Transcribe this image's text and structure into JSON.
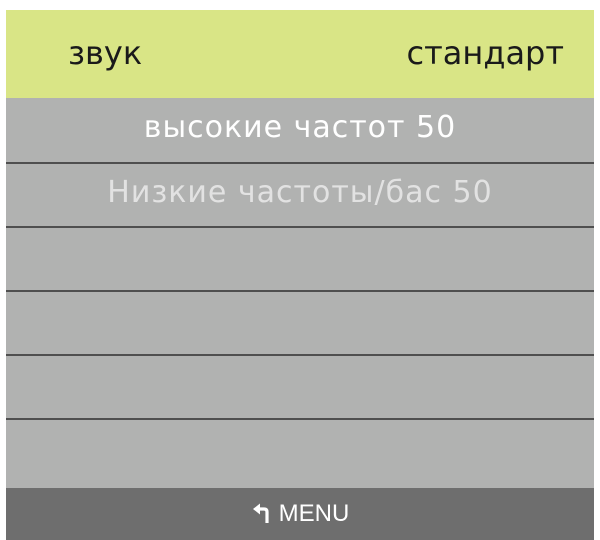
{
  "header": {
    "title": "звук",
    "value": "стандарт"
  },
  "menu": {
    "items": [
      {
        "label": "высокие частот  50"
      },
      {
        "label": "Низкие частоты/бас 50"
      },
      {
        "label": ""
      },
      {
        "label": ""
      },
      {
        "label": ""
      },
      {
        "label": ""
      }
    ]
  },
  "footer": {
    "icon": "back-arrow-icon",
    "label": "MENU"
  },
  "colors": {
    "header_bg": "#d9e586",
    "list_bg": "#b1b2b1",
    "footer_bg": "#6e6e6e",
    "divider": "#4f4f4f"
  }
}
